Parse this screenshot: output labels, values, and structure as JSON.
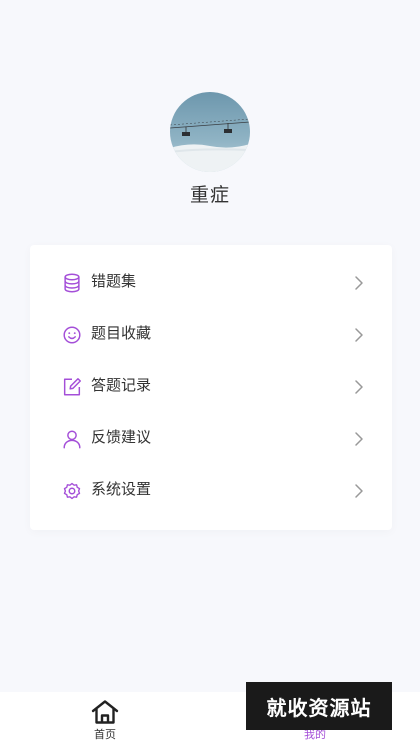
{
  "profile": {
    "username": "重症"
  },
  "menu": {
    "items": [
      {
        "label": "错题集",
        "icon": "database-icon"
      },
      {
        "label": "题目收藏",
        "icon": "smile-icon"
      },
      {
        "label": "答题记录",
        "icon": "edit-icon"
      },
      {
        "label": "反馈建议",
        "icon": "user-icon"
      },
      {
        "label": "系统设置",
        "icon": "settings-icon"
      }
    ]
  },
  "tabbar": {
    "tabs": [
      {
        "label": "首页",
        "icon": "home-icon",
        "active": false
      },
      {
        "label": "我的",
        "icon": "profile-icon",
        "active": true
      }
    ]
  },
  "watermark": {
    "text": "就收资源站"
  },
  "colors": {
    "accent": "#a44fd8",
    "background": "#f7f8fc",
    "card": "#ffffff",
    "text": "#333333",
    "chevron": "#999999"
  }
}
